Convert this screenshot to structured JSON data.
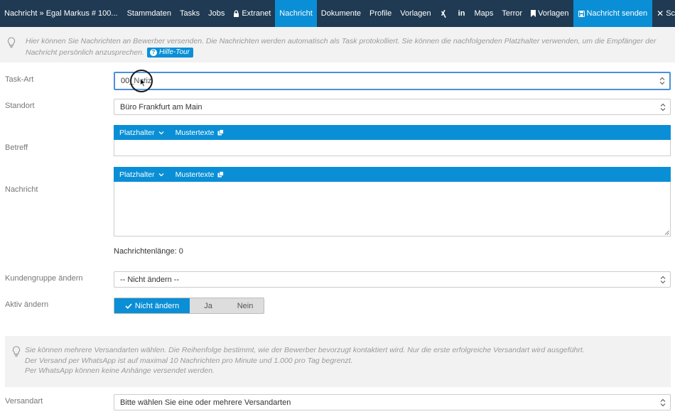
{
  "nav": {
    "brand": "Nachricht » Egal Markus # 100...",
    "items": [
      "Stammdaten",
      "Tasks",
      "Jobs",
      "Extranet",
      "Nachricht",
      "Dokumente",
      "Profile",
      "Vorlagen"
    ],
    "maps": "Maps",
    "terror": "Terror",
    "vorlagen2": "Vorlagen",
    "send": "Nachricht senden",
    "close": "Schließen",
    "active_color": "#0a8fd6",
    "bar_color": "#1f3a52"
  },
  "info1": {
    "text": "Hier können Sie Nachrichten an Bewerber versenden. Die Nachrichten werden automatisch als Task protokolliert. Sie können die nachfolgenden Platzhalter verwenden, um die Empfänger der Nachricht persönlich anzusprechen.",
    "help": "Hilfe-Tour"
  },
  "form": {
    "task_art_label": "Task-Art",
    "task_art_value": "00_Notiz",
    "standort_label": "Standort",
    "standort_value": "Büro Frankfurt am Main",
    "betreff_label": "Betreff",
    "nachricht_label": "Nachricht",
    "placeholder_btn": "Platzhalter",
    "mustertexte_btn": "Mustertexte",
    "message_length": "Nachrichtenlänge: 0",
    "kundengruppe_label": "Kundengruppe ändern",
    "kundengruppe_value": "-- Nicht ändern --",
    "aktiv_label": "Aktiv ändern",
    "aktiv_options": [
      "Nicht ändern",
      "Ja",
      "Nein"
    ],
    "versandart_label": "Versandart",
    "versandart_value": "Bitte wählen Sie eine oder mehrere Versandarten"
  },
  "info2": {
    "line1": "Sie können mehrere Versandarten wählen. Die Reihenfolge bestimmt, wie der Bewerber bevorzugt kontaktiert wird. Nur die erste erfolgreiche Versandart wird ausgeführt.",
    "line2": "Der Versand per WhatsApp ist auf maximal 10 Nachrichten pro Minute und 1.000 pro Tag begrenzt.",
    "line3": "Per WhatsApp können keine Anhänge versendet werden."
  }
}
